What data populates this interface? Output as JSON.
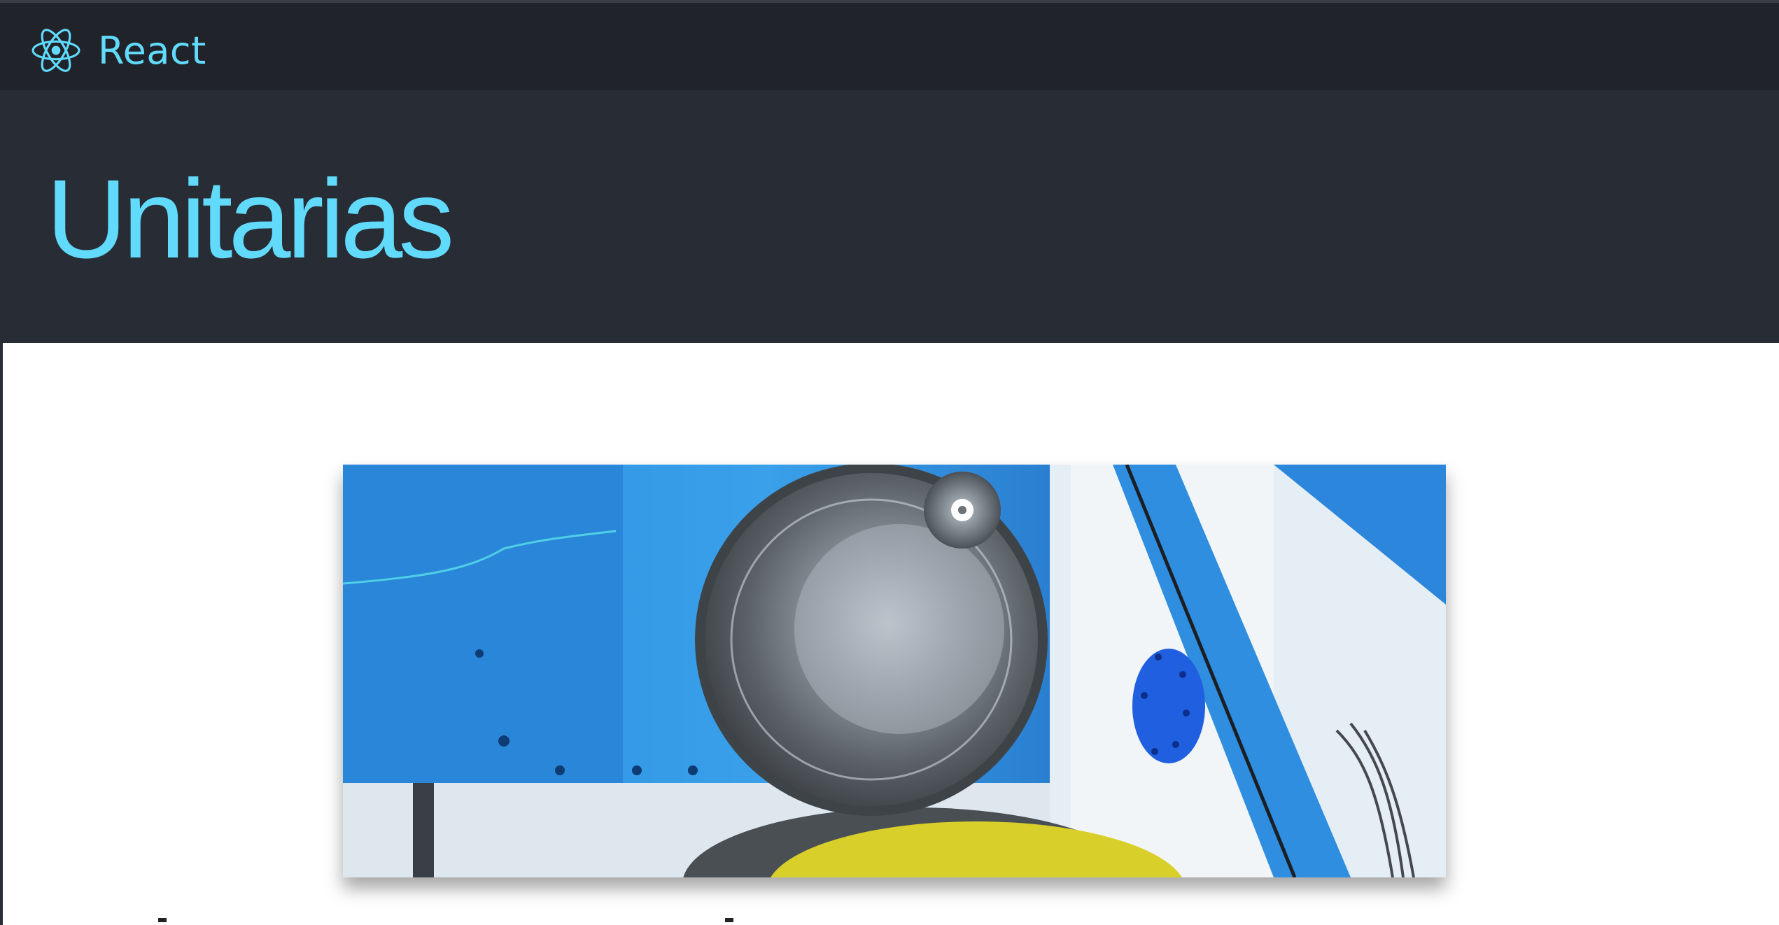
{
  "navbar": {
    "brand_label": "React",
    "brand_icon": "react-atom-icon",
    "accent_color": "#61dafb",
    "background_color": "#20232a"
  },
  "hero": {
    "title": "Unitarias",
    "background_color": "#282c34"
  },
  "content": {
    "banner_image": "tire-testing-machine-photo"
  }
}
